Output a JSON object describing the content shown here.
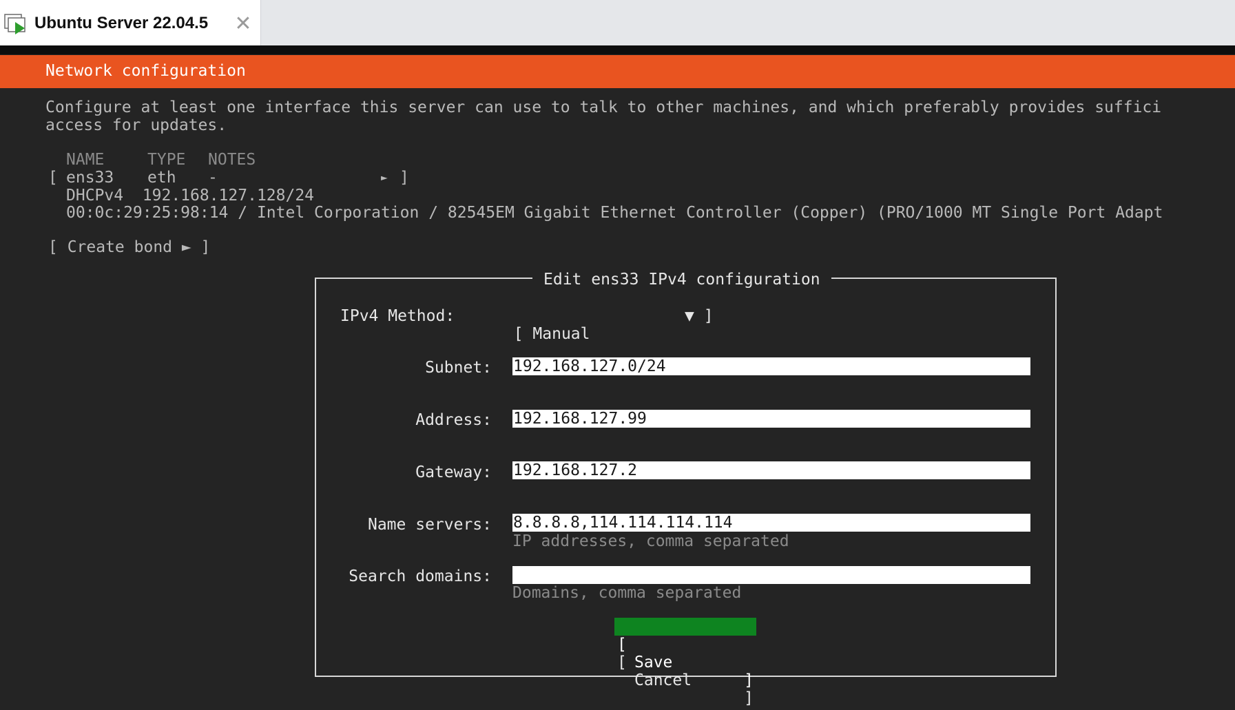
{
  "window": {
    "tab_title": "Ubuntu Server 22.04.5",
    "tab_icon": "vm-play-icon",
    "close_glyph": "✕"
  },
  "header": {
    "title": "Network configuration"
  },
  "intro": {
    "line1": "Configure at least one interface this server can use to talk to other machines, and which preferably provides suffici",
    "line2": "access for updates."
  },
  "interfaces": {
    "columns": [
      "NAME",
      "TYPE",
      "NOTES"
    ],
    "row": {
      "open": "[",
      "name": "ens33",
      "type": "eth",
      "notes": "-",
      "arrow": "►",
      "close": "]"
    },
    "dhcp": "DHCPv4  192.168.127.128/24",
    "hw": "00:0c:29:25:98:14 / Intel Corporation / 82545EM Gigabit Ethernet Controller (Copper) (PRO/1000 MT Single Port Adapt"
  },
  "create_bond": "[ Create bond ► ]",
  "dialog": {
    "title": "Edit ens33 IPv4 configuration",
    "method_label": "IPv4 Method:",
    "method_value": "[ Manual",
    "method_arrow": "▼ ]",
    "subnet_label": "Subnet:",
    "subnet_value": "192.168.127.0/24",
    "address_label": "Address:",
    "address_value": "192.168.127.99",
    "gateway_label": "Gateway:",
    "gateway_value": "192.168.127.2",
    "nameservers_label": "Name servers:",
    "nameservers_value": "8.8.8.8,114.114.114.114",
    "nameservers_hint": "IP addresses, comma separated",
    "searchdomains_label": "Search domains:",
    "searchdomains_value": "",
    "searchdomains_hint": "Domains, comma separated",
    "save_label": "Save",
    "cancel_label": "Cancel",
    "bracket_open": "[",
    "bracket_close": "]"
  },
  "colors": {
    "header": "#e95420",
    "save_button": "#0e8420",
    "console_bg": "#242424"
  }
}
